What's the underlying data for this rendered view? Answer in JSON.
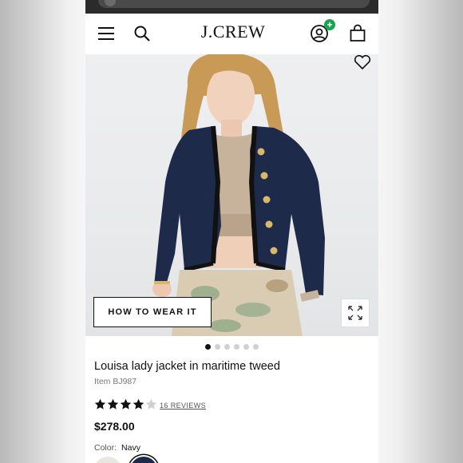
{
  "header": {
    "logo": "J.CREW",
    "account_badge": "+"
  },
  "hero": {
    "how_to_wear_label": "HOW TO WEAR IT",
    "image_count": 6,
    "active_image": 1
  },
  "product": {
    "title": "Louisa lady jacket in maritime tweed",
    "item_number": "Item BJ987",
    "rating": 4,
    "rating_max": 5,
    "reviews_label": "16 REVIEWS",
    "price": "$278.00",
    "color_label": "Color:",
    "color_value": "Navy"
  },
  "colors": {
    "badge": "#1aa24f",
    "jacket": "#1e2a4a",
    "trim": "#111111"
  }
}
